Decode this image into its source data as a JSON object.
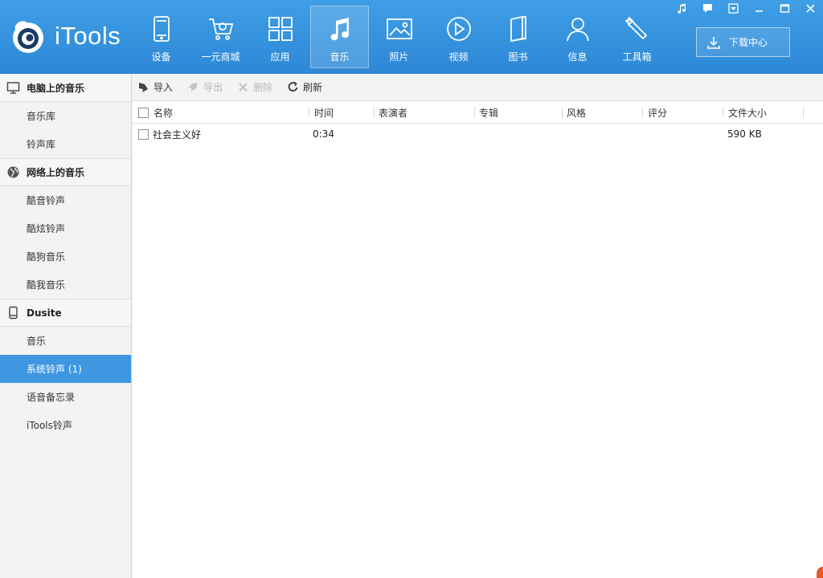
{
  "app": {
    "name": "iTools"
  },
  "nav": [
    {
      "id": "device",
      "label": "设备",
      "icon": "phone-icon"
    },
    {
      "id": "shop",
      "label": "一元商城",
      "icon": "cart-icon"
    },
    {
      "id": "apps",
      "label": "应用",
      "icon": "apps-grid-icon"
    },
    {
      "id": "music",
      "label": "音乐",
      "icon": "music-note-icon",
      "active": true
    },
    {
      "id": "photos",
      "label": "照片",
      "icon": "photo-icon"
    },
    {
      "id": "video",
      "label": "视频",
      "icon": "play-icon"
    },
    {
      "id": "books",
      "label": "图书",
      "icon": "book-icon"
    },
    {
      "id": "messages",
      "label": "信息",
      "icon": "person-icon"
    },
    {
      "id": "tools",
      "label": "工具箱",
      "icon": "wrench-icon"
    }
  ],
  "download_center": {
    "label": "下载中心"
  },
  "sidebar": {
    "groups": [
      {
        "title": "电脑上的音乐",
        "icon": "monitor-icon",
        "items": [
          "音乐库",
          "铃声库"
        ]
      },
      {
        "title": "网络上的音乐",
        "icon": "globe-icon",
        "items": [
          "酷音铃声",
          "酷炫铃声",
          "酷狗音乐",
          "酷我音乐"
        ]
      },
      {
        "title": "Dusite",
        "icon": "device-icon",
        "items": [
          "音乐",
          "系统铃声 (1)",
          "语音备忘录",
          "iTools铃声"
        ]
      }
    ],
    "selected": "系统铃声 (1)"
  },
  "toolbar": {
    "import": "导入",
    "export": "导出",
    "delete": "删除",
    "refresh": "刷新"
  },
  "table": {
    "columns": [
      "名称",
      "时间",
      "表演者",
      "专辑",
      "风格",
      "评分",
      "文件大小"
    ],
    "rows": [
      {
        "name": "社会主义好",
        "time": "0:34",
        "artist": "",
        "album": "",
        "genre": "",
        "rating": "",
        "size": "590 KB"
      }
    ]
  },
  "colors": {
    "header": "#2d88d6",
    "selected": "#3f97e2"
  }
}
